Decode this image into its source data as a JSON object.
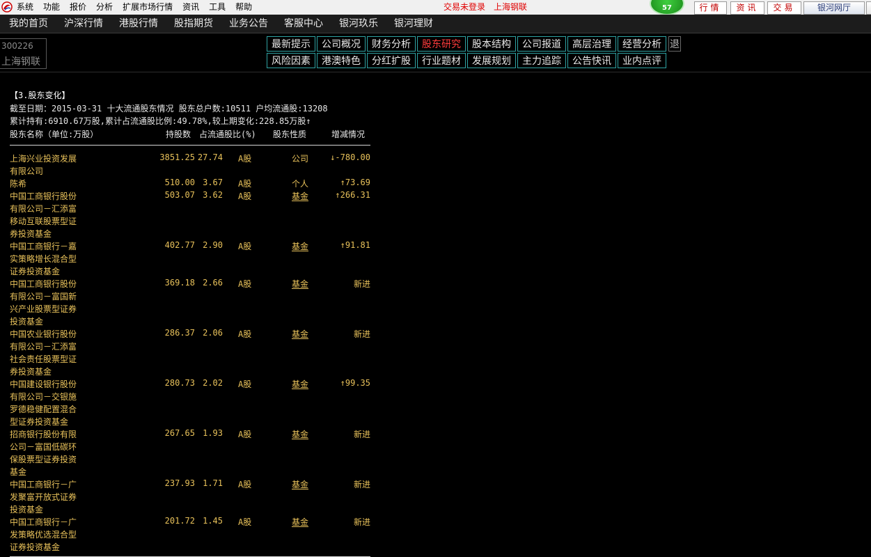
{
  "menubar": {
    "items": [
      "系统",
      "功能",
      "报价",
      "分析",
      "扩展市场行情",
      "资讯",
      "工具",
      "帮助"
    ],
    "login_status": "交易未登录",
    "stock_name": "上海钢联",
    "badge": "57",
    "buttons": [
      "行情",
      "资讯",
      "交易",
      "银河网厅"
    ]
  },
  "navbar": {
    "items": [
      "我的首页",
      "沪深行情",
      "港股行情",
      "股指期货",
      "业务公告",
      "客服中心",
      "银河玖乐",
      "银河理财"
    ]
  },
  "stock": {
    "code": "300226",
    "name": "上海钢联"
  },
  "tabs": {
    "row1": [
      "最新提示",
      "公司概况",
      "财务分析",
      "股东研究",
      "股本结构",
      "公司报道",
      "高层治理",
      "经营分析"
    ],
    "row2": [
      "风险因素",
      "港澳特色",
      "分红扩股",
      "行业题材",
      "发展规划",
      "主力追踪",
      "公告快讯",
      "业内点评"
    ],
    "exit": "退",
    "active": "股东研究"
  },
  "section": {
    "title": "【3.股东变化】",
    "line1": "截至日期：2015-03-31 十大流通股东情况 股东总户数:10511 户均流通股:13208",
    "line2": "累计持有:6910.67万股,累计占流通股比例:49.78%,较上期变化:228.85万股",
    "line2_arrow": "↑",
    "columns": [
      "股东名称（单位:万股）",
      "持股数",
      "占流通股比(%)",
      "股东性质",
      "增减情况"
    ],
    "rows": [
      {
        "name": "上海兴业投资发展有限公司",
        "shares": "3851.25",
        "ratio": "27.74",
        "type": "A股",
        "nature": "公司",
        "change": "↓-780.00"
      },
      {
        "name": "陈希",
        "shares": "510.00",
        "ratio": "3.67",
        "type": "A股",
        "nature": "个人",
        "change": "↑73.69"
      },
      {
        "name": "中国工商银行股份有限公司－汇添富移动互联股票型证券投资基金",
        "shares": "503.07",
        "ratio": "3.62",
        "type": "A股",
        "nature": "基金",
        "change": "↑266.31"
      },
      {
        "name": "中国工商银行－嘉实策略增长混合型证券投资基金",
        "shares": "402.77",
        "ratio": "2.90",
        "type": "A股",
        "nature": "基金",
        "change": "↑91.81"
      },
      {
        "name": "中国工商银行股份有限公司－富国新兴产业股票型证券投资基金",
        "shares": "369.18",
        "ratio": "2.66",
        "type": "A股",
        "nature": "基金",
        "change": "新进"
      },
      {
        "name": "中国农业银行股份有限公司－汇添富社会责任股票型证券投资基金",
        "shares": "286.37",
        "ratio": "2.06",
        "type": "A股",
        "nature": "基金",
        "change": "新进"
      },
      {
        "name": "中国建设银行股份有限公司－交银施罗德稳健配置混合型证券投资基金",
        "shares": "280.73",
        "ratio": "2.02",
        "type": "A股",
        "nature": "基金",
        "change": "↑99.35"
      },
      {
        "name": "招商银行股份有限公司－富国低碳环保股票型证券投资基金",
        "shares": "267.65",
        "ratio": "1.93",
        "type": "A股",
        "nature": "基金",
        "change": "新进"
      },
      {
        "name": "中国工商银行－广发聚富开放式证券投资基金",
        "shares": "237.93",
        "ratio": "1.71",
        "type": "A股",
        "nature": "基金",
        "change": "新进"
      },
      {
        "name": "中国工商银行－广发策略优选混合型证券投资基金",
        "shares": "201.72",
        "ratio": "1.45",
        "type": "A股",
        "nature": "基金",
        "change": "新进"
      }
    ]
  }
}
